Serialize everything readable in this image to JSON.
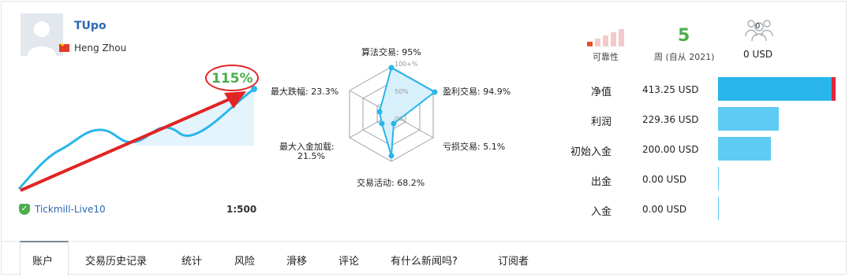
{
  "profile": {
    "name": "TUpo",
    "location": "Heng Zhou",
    "growth": "115%",
    "broker": "Tickmill-Live10",
    "leverage": "1:500"
  },
  "radar": {
    "labels": {
      "algo": "算法交易: 95%",
      "profit_trades": "盈利交易: 94.9%",
      "loss_trades": "亏损交易: 5.1%",
      "activity": "交易活动: 68.2%",
      "max_deposit_load_1": "最大入金加载:",
      "max_deposit_load_2": "21.5%",
      "max_drawdown": "最大跌幅: 23.3%",
      "scale_100": "100+%",
      "scale_50": "50%",
      "scale_0": "0%"
    },
    "values": {
      "algo": 95,
      "profit_trades": 94.9,
      "loss_trades": 5.1,
      "activity": 68.2,
      "max_deposit_load": 21.5,
      "max_drawdown": 23.3
    }
  },
  "stats": {
    "reliability_label": "可靠性",
    "weeks_value": "5",
    "weeks_label": "周 (自从 2021)",
    "subscribers_count": "0",
    "subscribers_funds": "0 USD"
  },
  "metrics": [
    {
      "label": "净值",
      "value": "413.25 USD",
      "level": 1.0
    },
    {
      "label": "利润",
      "value": "229.36 USD",
      "level": 0.555
    },
    {
      "label": "初始入金",
      "value": "200.00 USD",
      "level": 0.484
    },
    {
      "label": "出金",
      "value": "0.00 USD",
      "level": 0
    },
    {
      "label": "入金",
      "value": "0.00 USD",
      "level": 0
    }
  ],
  "tabs": [
    "账户",
    "交易历史记录",
    "统计",
    "风险",
    "滑移",
    "评论",
    "有什么新闻吗?",
    "订阅者"
  ],
  "colors": {
    "accent_blue": "#29b6ea",
    "bar_blue": "#5ecbf4",
    "green": "#4cae4c",
    "red": "#e02424",
    "link": "#2a6ab0"
  }
}
